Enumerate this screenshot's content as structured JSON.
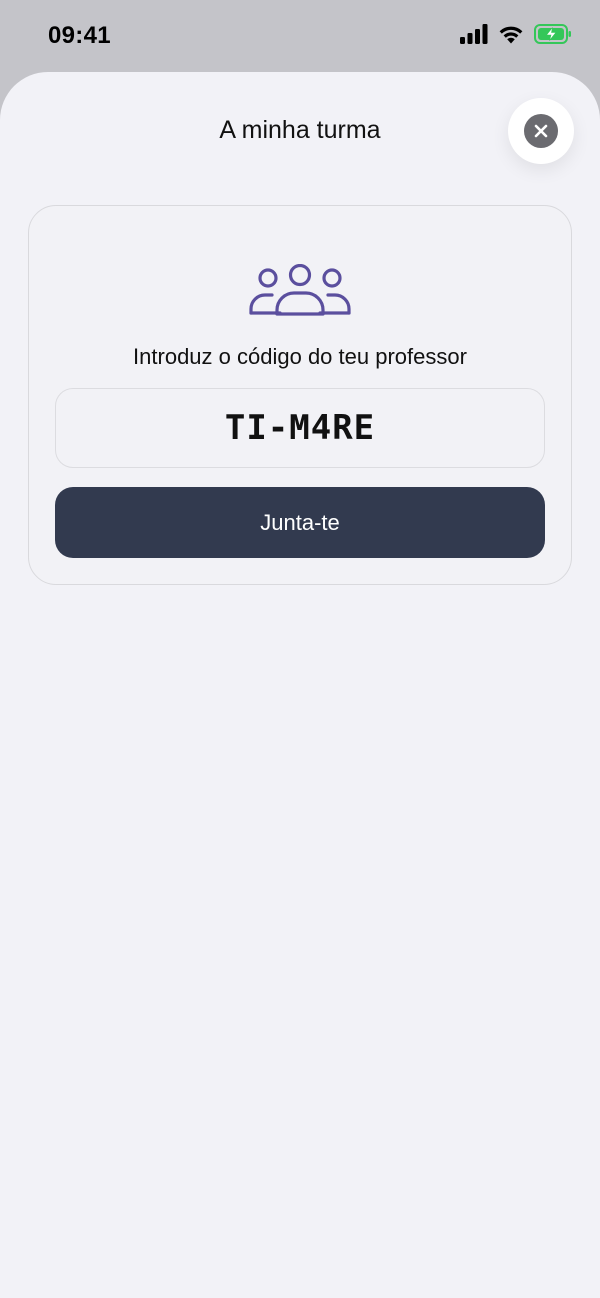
{
  "status_bar": {
    "time": "09:41"
  },
  "sheet": {
    "title": "A minha turma",
    "close_icon": "xmark-circle-icon"
  },
  "card": {
    "icon": "group-people-icon",
    "prompt": "Introduz o código do teu professor",
    "code_value": "TI-M4RE",
    "join_label": "Junta-te"
  },
  "colors": {
    "accent_icon": "#5b4f9e",
    "button_bg": "#323a4f",
    "sheet_bg": "#f2f2f7",
    "battery_green": "#34c759"
  }
}
